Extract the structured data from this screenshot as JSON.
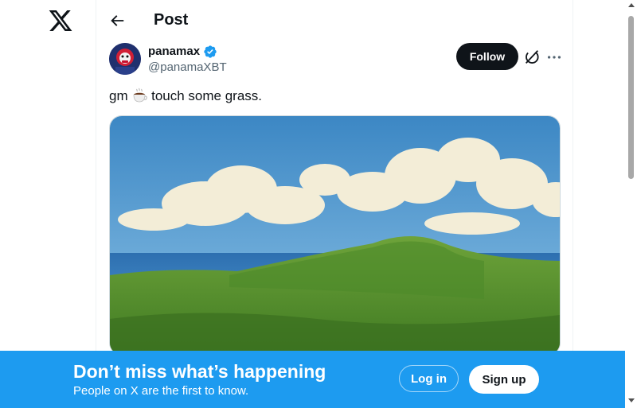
{
  "app": {
    "logo_icon": "x-logo-icon"
  },
  "header": {
    "title": "Post",
    "back_icon": "arrow-left-icon"
  },
  "post": {
    "author": {
      "display_name": "panamax",
      "handle": "@panamaXBT",
      "verified": true,
      "verified_color": "#1d9bf0"
    },
    "follow_label": "Follow",
    "text_before": "gm",
    "text_emoji": "hot-beverage-icon",
    "text_after": " touch some grass.",
    "media": {
      "type": "image",
      "icon": "landscape-painting"
    },
    "actions": {
      "grok_icon": "grok-icon",
      "more_icon": "more-icon"
    }
  },
  "banner": {
    "title": "Don’t miss what’s happening",
    "subtitle": "People on X are the first to know.",
    "login_label": "Log in",
    "signup_label": "Sign up",
    "background": "#1d9bf0"
  }
}
